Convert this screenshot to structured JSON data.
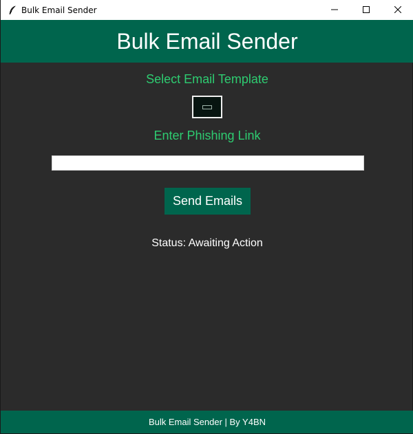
{
  "window": {
    "title": "Bulk Email Sender",
    "icons": {
      "app": "feather-icon",
      "minimize": "minimize-icon",
      "maximize": "maximize-icon",
      "close": "close-icon"
    }
  },
  "header": {
    "title": "Bulk Email Sender"
  },
  "form": {
    "template_label": "Select Email Template",
    "template_selected": "",
    "link_label": "Enter Phishing Link",
    "link_value": "",
    "link_placeholder": "",
    "send_button_label": "Send Emails"
  },
  "status": {
    "text": "Status: Awaiting Action"
  },
  "footer": {
    "text": "Bulk Email Sender | By Y4BN"
  },
  "colors": {
    "accent": "#00654d",
    "label_green": "#2ecc71",
    "background": "#2b2b2b",
    "text": "#ffffff"
  }
}
